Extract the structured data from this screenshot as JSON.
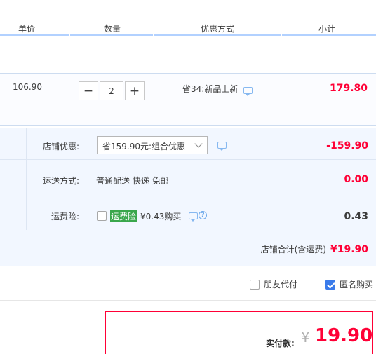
{
  "header": {
    "col_unit_price": "单价",
    "col_quantity": "数量",
    "col_promo": "优惠方式",
    "col_subtotal": "小计"
  },
  "item": {
    "unit_price": "106.90",
    "quantity": "2",
    "minus": "−",
    "plus": "+",
    "promo": "省34:新品上新",
    "subtotal": "179.80"
  },
  "shop": {
    "discount_label": "店铺优惠:",
    "discount_select": "省159.90元:组合优惠",
    "discount_value": "-159.90",
    "shipping_label": "运送方式:",
    "shipping_text": "普通配送 快递 免邮",
    "shipping_value": "0.00",
    "insurance_label": "运费险:",
    "insurance_tag": "运费险",
    "insurance_text": "¥0.43购买",
    "insurance_value": "0.43",
    "total_label": "店铺合计(含运费)",
    "total_value": "¥19.90"
  },
  "options": {
    "friend_pay": "朋友代付",
    "anonymous": "匿名购买",
    "anonymous_checked": true,
    "friend_pay_checked": false
  },
  "pay": {
    "label": "实付款:",
    "currency": "¥",
    "amount": "19.90"
  },
  "colors": {
    "price_red": "#ff0036",
    "header_line": "#b2d1ff",
    "checkbox_blue": "#3a7bea",
    "highlight_green": "#3aa74c"
  }
}
